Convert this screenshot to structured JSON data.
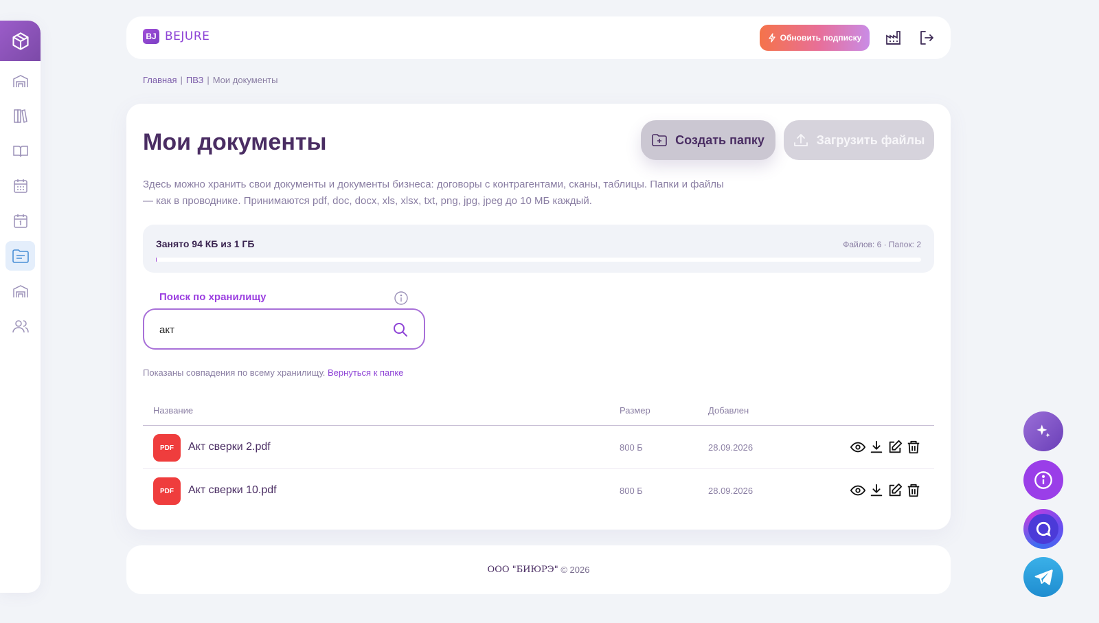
{
  "header": {
    "brand_mark": "BJ",
    "brand_name": "BEJURE",
    "upgrade_label": "Обновить подписку"
  },
  "breadcrumb": {
    "items": [
      "Главная",
      "ПВЗ",
      "Мои документы"
    ],
    "separator": "|"
  },
  "main": {
    "title": "Мои документы",
    "create_folder_label": "Создать папку",
    "upload_files_label": "Загрузить файлы",
    "description": "Здесь можно хранить свои документы и документы бизнеса: договоры с контрагентами, сканы, таблицы. Папки и файлы — как в проводнике. Принимаются pdf, doc, docx, xls, xlsx, txt, png, jpg, jpeg до 10 МБ каждый.",
    "storage": {
      "used_text": "Занято 94 КБ из 1 ГБ",
      "counts_text": "Файлов: 6 · Папок: 2",
      "used_fraction": 0.0001
    },
    "search": {
      "label": "Поиск по хранилищу",
      "value": "акт"
    },
    "match_note": {
      "text": "Показаны совпадения по всему хранилищу.",
      "link": "Вернуться к папке"
    },
    "table": {
      "columns": [
        "Название",
        "Размер",
        "Добавлен"
      ],
      "rows": [
        {
          "type": "PDF",
          "name": "Акт сверки 2.pdf",
          "size": "800 Б",
          "date": "28.09.2026"
        },
        {
          "type": "PDF",
          "name": "Акт сверки 10.pdf",
          "size": "800 Б",
          "date": "28.09.2026"
        }
      ]
    }
  },
  "footer": {
    "company": "ООО \"БИЮРЭ\"",
    "copyright": "© 2026"
  },
  "sidebar": {
    "items": [
      "box-icon",
      "warehouse-icon",
      "library-icon",
      "book-icon",
      "calendar-grid-icon",
      "calendar-day-icon",
      "documents-icon",
      "warehouse-alt-icon",
      "users-icon"
    ],
    "active": "documents-icon"
  },
  "colors": {
    "accent": "#8e44d6",
    "title": "#4a2d63",
    "muted": "#8a7ea3",
    "pdf": "#ef3d3d",
    "background": "#f2f4f8"
  }
}
